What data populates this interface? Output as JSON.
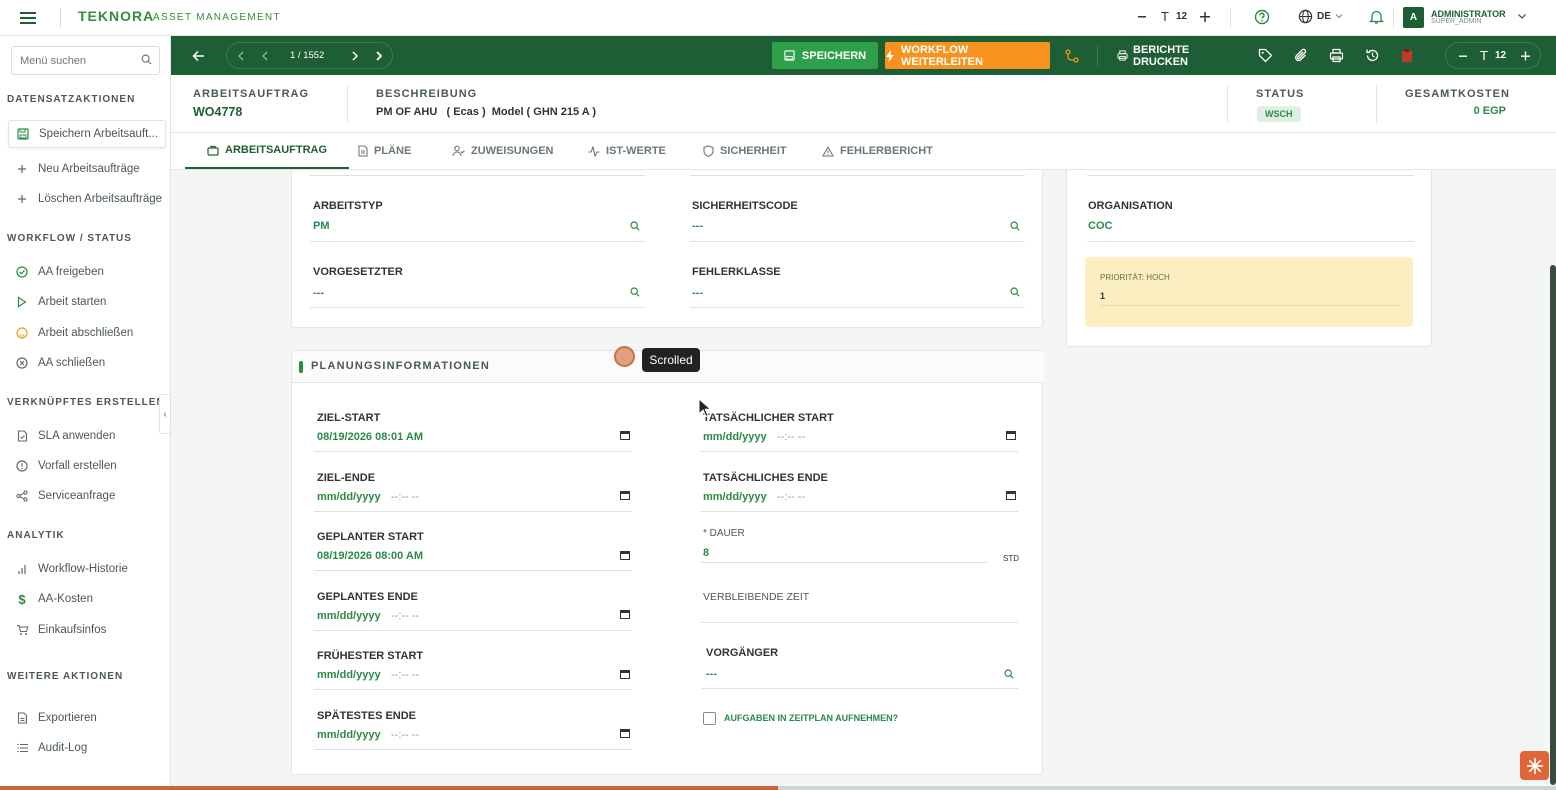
{
  "header": {
    "brand": "TEKNORA",
    "brand_sub": "ASSET MANAGEMENT",
    "font_size": "12",
    "language": "DE",
    "user_name": "ADMINISTRATOR",
    "user_role": "SUPER_ADMIN",
    "avatar_letter": "A"
  },
  "sidebar": {
    "search_placeholder": "Menü suchen",
    "sections": {
      "record_actions": "DATENSATZAKTIONEN",
      "workflow": "WORKFLOW / STATUS",
      "linked": "VERKNÜPFTES ERSTELLEN",
      "analytics": "ANALYTIK",
      "more": "WEITERE AKTIONEN"
    },
    "items": {
      "save": "Speichern Arbeitsauft...",
      "new": "Neu Arbeitsaufträge",
      "delete": "Löschen Arbeitsaufträge",
      "release": "AA freigeben",
      "start": "Arbeit starten",
      "complete": "Arbeit abschließen",
      "close": "AA schließen",
      "sla": "SLA anwenden",
      "incident": "Vorfall erstellen",
      "service": "Serviceanfrage",
      "history": "Workflow-Historie",
      "costs": "AA-Kosten",
      "purchasing": "Einkaufsinfos",
      "export": "Exportieren",
      "audit": "Audit-Log"
    }
  },
  "toolbar": {
    "pager_text": "1 / 1552",
    "save_label": "SPEICHERN",
    "workflow_label": "WORKFLOW WEITERLEITEN",
    "reports_label": "BERICHTE DRUCKEN",
    "zoom": "12"
  },
  "record": {
    "workorder_label": "ARBEITSAUFTRAG",
    "workorder_value": "WO4778",
    "description_label": "BESCHREIBUNG",
    "description_value": "PM OF AHU   ( Ecas )  Model ( GHN 215 A )",
    "status_label": "STATUS",
    "status_value": "WSCH",
    "total_label": "GESAMTKOSTEN",
    "total_value": "0 EGP"
  },
  "tabs": [
    "ARBEITSAUFTRAG",
    "PLÄNE",
    "ZUWEISUNGEN",
    "IST-WERTE",
    "SICHERHEIT",
    "FEHLERBERICHT"
  ],
  "form_top": {
    "worktype_label": "ARBEITSTYP",
    "worktype_value": "PM",
    "safety_label": "SICHERHEITSCODE",
    "safety_value": "---",
    "supervisor_label": "VORGESETZTER",
    "supervisor_value": "---",
    "errorclass_label": "FEHLERKLASSE",
    "errorclass_value": "---",
    "org_label": "ORGANISATION",
    "org_value": "COC",
    "priority_label": "PRIORITÄT: HOCH",
    "priority_value": "1"
  },
  "planning": {
    "title": "PLANUNGSINFORMATIONEN",
    "target_start_label": "ZIEL-START",
    "target_start_value": "08/19/2026 08:01 AM",
    "actual_start_label": "TATSÄCHLICHER START",
    "actual_start_value": "mm/dd/yyyy",
    "target_end_label": "ZIEL-ENDE",
    "target_end_value": "mm/dd/yyyy",
    "actual_end_label": "TATSÄCHLICHES ENDE",
    "actual_end_value": "mm/dd/yyyy",
    "planned_start_label": "GEPLANTER START",
    "planned_start_value": "08/19/2026 08:00 AM",
    "duration_label": "* DAUER",
    "duration_value": "8",
    "duration_unit": "STD",
    "planned_end_label": "GEPLANTES ENDE",
    "planned_end_value": "mm/dd/yyyy",
    "remaining_label": "VERBLEIBENDE ZEIT",
    "earliest_start_label": "FRÜHESTER START",
    "earliest_start_value": "mm/dd/yyyy",
    "predecessor_label": "VORGÄNGER",
    "predecessor_value": "---",
    "latest_end_label": "SPÄTESTES ENDE",
    "latest_end_value": "mm/dd/yyyy",
    "schedule_label": "AUFGABEN IN ZEITPLAN AUFNEHMEN?",
    "time_placeholder": "--:-- --"
  },
  "overlay": {
    "scroll_tooltip": "Scrolled"
  },
  "progress": {
    "fraction": 0.5
  },
  "colors": {
    "brand_green": "#1e5e34",
    "accent_green": "#2c8a45",
    "save_green": "#2fa04a",
    "workflow_orange": "#f7931e",
    "priority_bg": "#fbefc2"
  }
}
